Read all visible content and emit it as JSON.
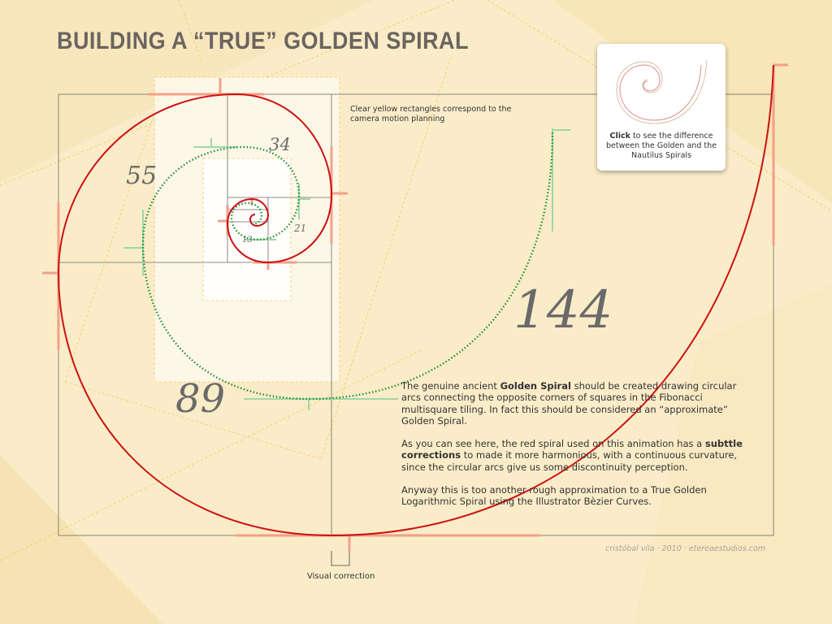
{
  "title": "BUILDING A “TRUE” GOLDEN SPIRAL",
  "yellow_note": "Clear yellow rectangles correspond to the camera motion planning",
  "card": {
    "caption_bold": "Click",
    "caption_rest": " to see the difference between the Golden and the Nautilus Spirals"
  },
  "fibonacci_labels": {
    "n144": "144",
    "n89": "89",
    "n55": "55",
    "n34": "34",
    "n21": "21",
    "n13": "13"
  },
  "body": {
    "p1_pre": "The genuine ancient ",
    "p1_bold": "Golden Spiral",
    "p1_post": " should be created drawing circular arcs connecting the opposite corners of squares in the Fibonacci multisquare tiling. In fact this should be considered an “approximate” Golden Spiral.",
    "p2_pre": "As you can see here, the red spiral used on this animation has a ",
    "p2_bold": "subttle corrections",
    "p2_post": " to made it more harmonious, with a continuous curvature, since the circular arcs give us some discontinuity perception.",
    "p3": "Anyway this is too another rough approximation to a True Golden Logarithmic Spiral using the Illustrator Bèzier Curves."
  },
  "visual_correction": "Visual correction",
  "credit": "cristóbal vila · 2010 · etereaestudios.com",
  "colors": {
    "background": "#faecc8",
    "red_spiral": "#cc1111",
    "green_spiral": "#1f8f3a",
    "tick_orange": "#f2a088",
    "tick_green": "#9fd8a6",
    "title": "#6b6460"
  }
}
